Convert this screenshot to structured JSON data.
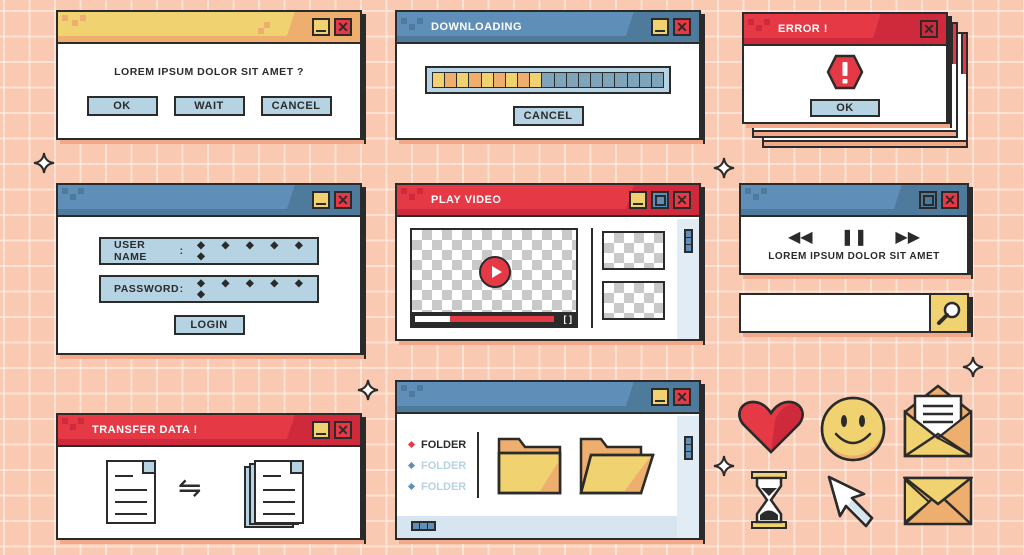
{
  "dialog": {
    "title": "",
    "message": "LOREM IPSUM DOLOR SIT AMET ?",
    "buttons": {
      "ok": "OK",
      "wait": "WAIT",
      "cancel": "CANCEL"
    }
  },
  "download": {
    "title": "DOWNLOADING",
    "progress_segments_total": 19,
    "progress_segments_filled": 9,
    "cancel_label": "CANCEL"
  },
  "error": {
    "title": "ERROR !",
    "icon": "warning-octagon-icon",
    "ok_label": "OK"
  },
  "login": {
    "username_label": "USER NAME",
    "password_label": "PASSWORD",
    "separator": ":",
    "username_value": "◆ ◆ ◆ ◆ ◆ ◆",
    "password_value": "◆ ◆ ◆ ◆ ◆ ◆",
    "login_label": "LOGIN"
  },
  "video": {
    "title": "PLAY VIDEO",
    "progress_percent": 25
  },
  "media": {
    "rewind": "◀◀",
    "pause": "❚❚",
    "forward": "▶▶",
    "track": "LOREM IPSUM DOLOR SIT AMET"
  },
  "search": {
    "value": "",
    "placeholder": ""
  },
  "transfer": {
    "title": "TRANSFER DATA !",
    "arrow": "⇋"
  },
  "folder": {
    "items": [
      {
        "label": "FOLDER",
        "active": true
      },
      {
        "label": "FOLDER",
        "active": false
      },
      {
        "label": "FOLDER",
        "active": false
      }
    ]
  },
  "colors": {
    "background": "#f9c9b1",
    "yellow": "#f0d271",
    "orange": "#eeae6e",
    "blue": "#5f8fb8",
    "light_blue": "#b5d3e3",
    "red": "#e63946",
    "outline": "#2b2b2b"
  },
  "stickers": [
    "heart-icon",
    "smiley-icon",
    "open-envelope-icon",
    "hourglass-icon",
    "cursor-arrow-icon",
    "envelope-icon"
  ]
}
